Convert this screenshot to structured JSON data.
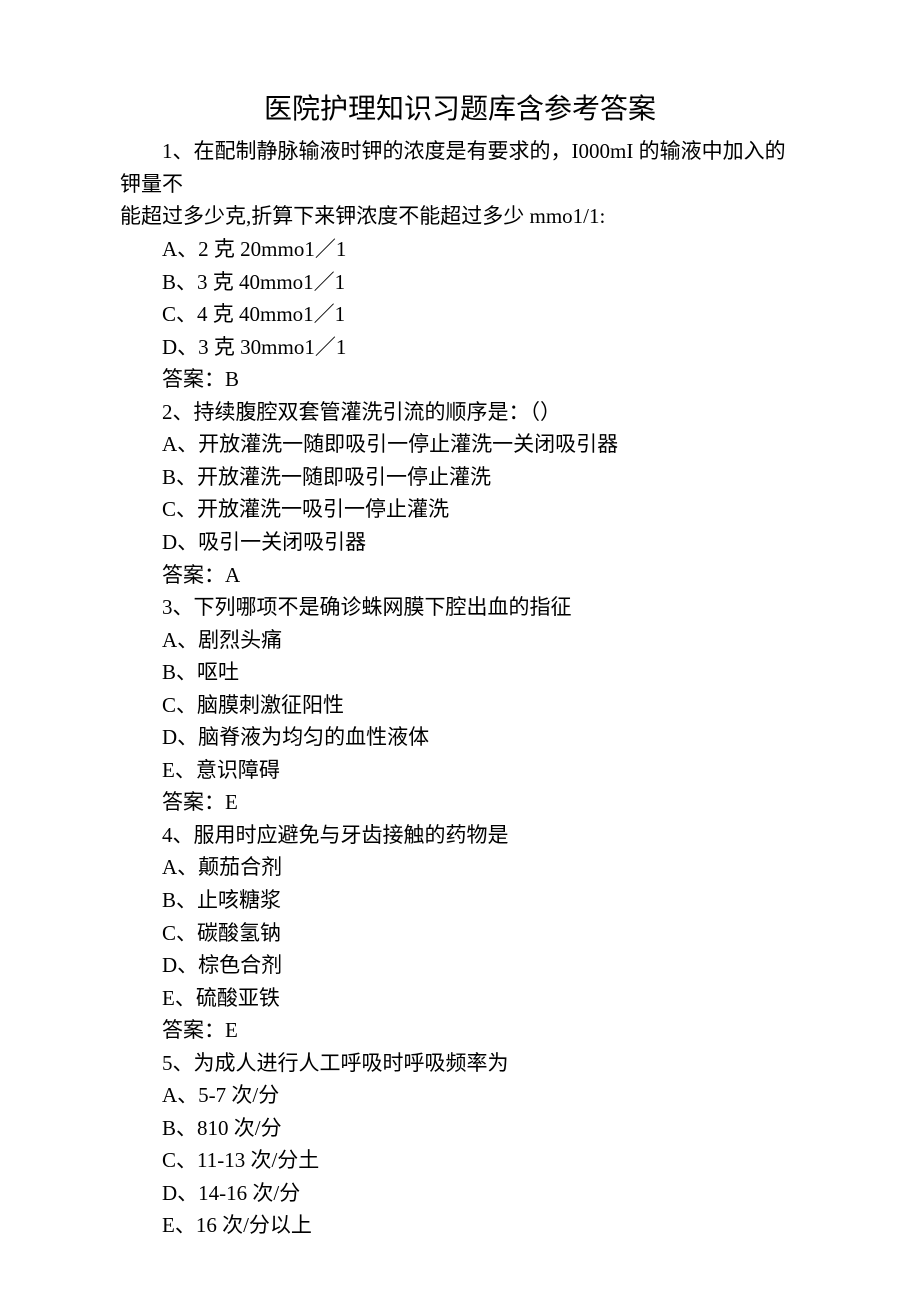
{
  "title": "医院护理知识习题库含参考答案",
  "questions": [
    {
      "stem1": "1、在配制静脉输液时钾的浓度是有要求的，I000mI 的输液中加入的钾量不",
      "stem2": "能超过多少克,折算下来钾浓度不能超过多少 mmo1/1:",
      "options": [
        "A、2 克 20mmo1／1",
        "B、3 克 40mmo1／1",
        "C、4 克 40mmo1／1",
        "D、3 克 30mmo1／1"
      ],
      "answer": "答案：B"
    },
    {
      "stem1": "2、持续腹腔双套管灌洗引流的顺序是：（）",
      "options": [
        "A、开放灌洗一随即吸引一停止灌洗一关闭吸引器",
        "B、开放灌洗一随即吸引一停止灌洗",
        "C、开放灌洗一吸引一停止灌洗",
        "D、吸引一关闭吸引器"
      ],
      "answer": "答案：A"
    },
    {
      "stem1": "3、下列哪项不是确诊蛛网膜下腔出血的指征",
      "options": [
        "A、剧烈头痛",
        "B、呕吐",
        "C、脑膜刺激征阳性",
        "D、脑脊液为均匀的血性液体",
        "E、意识障碍"
      ],
      "answer": "答案：E"
    },
    {
      "stem1": "4、服用时应避免与牙齿接触的药物是",
      "options": [
        "A、颠茄合剂",
        "B、止咳糖浆",
        "C、碳酸氢钠",
        "D、棕色合剂",
        "E、硫酸亚铁"
      ],
      "answer": "答案：E"
    },
    {
      "stem1": "5、为成人进行人工呼吸时呼吸频率为",
      "options": [
        "A、5-7 次/分",
        "B、810 次/分",
        "C、11-13 次/分土",
        "D、14-16 次/分",
        "E、16 次/分以上"
      ]
    }
  ]
}
